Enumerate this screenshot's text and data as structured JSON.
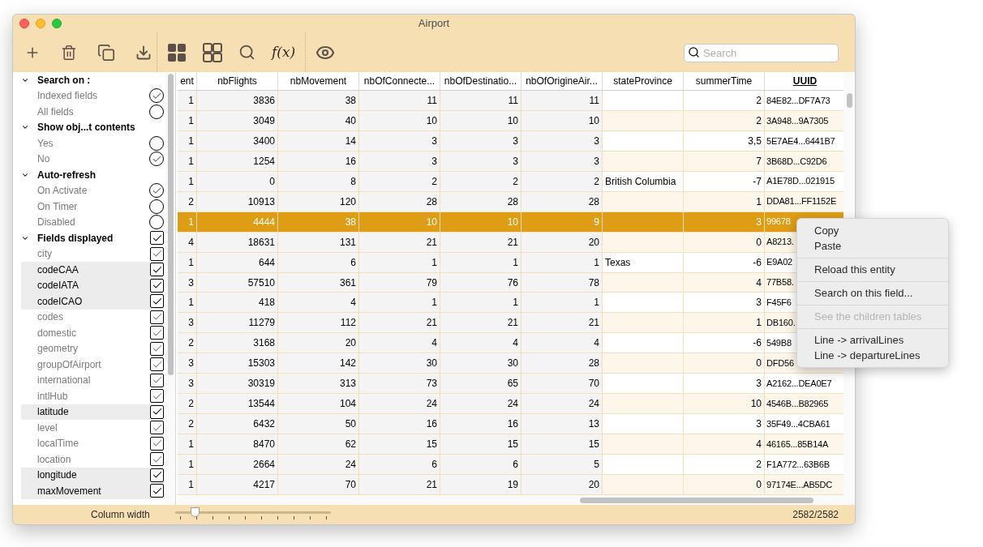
{
  "window": {
    "title": "Airport"
  },
  "toolbar": {
    "formula_label": "f(x)",
    "search": {
      "placeholder": "Search"
    }
  },
  "sidebar": {
    "sections": [
      {
        "title": "Search on :",
        "expanded": true,
        "kind": "radio",
        "items": [
          {
            "label": "Indexed fields",
            "selected": true,
            "highlighted": false
          },
          {
            "label": "All fields",
            "selected": false,
            "highlighted": false
          }
        ]
      },
      {
        "title": "Show obj...t contents",
        "expanded": true,
        "kind": "radio",
        "items": [
          {
            "label": "Yes",
            "selected": false,
            "highlighted": false
          },
          {
            "label": "No",
            "selected": true,
            "highlighted": false
          }
        ]
      },
      {
        "title": "Auto-refresh",
        "expanded": true,
        "kind": "radio",
        "items": [
          {
            "label": "On Activate",
            "selected": true,
            "highlighted": false
          },
          {
            "label": "On Timer",
            "selected": false,
            "highlighted": false
          },
          {
            "label": "Disabled",
            "selected": false,
            "highlighted": false
          }
        ]
      },
      {
        "title": "Fields displayed",
        "expanded": true,
        "kind": "checkbox",
        "checked": true,
        "items": [
          {
            "label": "city",
            "checked": true,
            "highlighted": false
          },
          {
            "label": "codeCAA",
            "checked": true,
            "highlighted": true
          },
          {
            "label": "codeIATA",
            "checked": true,
            "highlighted": true
          },
          {
            "label": "codeICAO",
            "checked": true,
            "highlighted": true
          },
          {
            "label": "codes",
            "checked": true,
            "highlighted": false
          },
          {
            "label": "domestic",
            "checked": true,
            "highlighted": false
          },
          {
            "label": "geometry",
            "checked": true,
            "highlighted": false
          },
          {
            "label": "groupOfAirport",
            "checked": true,
            "highlighted": false
          },
          {
            "label": "international",
            "checked": true,
            "highlighted": false
          },
          {
            "label": "intlHub",
            "checked": true,
            "highlighted": false
          },
          {
            "label": "latitude",
            "checked": true,
            "highlighted": true
          },
          {
            "label": "level",
            "checked": true,
            "highlighted": false
          },
          {
            "label": "localTime",
            "checked": true,
            "highlighted": false
          },
          {
            "label": "location",
            "checked": true,
            "highlighted": false
          },
          {
            "label": "longitude",
            "checked": true,
            "highlighted": true
          },
          {
            "label": "maxMovement",
            "checked": true,
            "highlighted": true
          }
        ]
      }
    ]
  },
  "table": {
    "columns": [
      {
        "label": "ent",
        "kind": "computed"
      },
      {
        "label": "nbFlights",
        "kind": "computed"
      },
      {
        "label": "nbMovement",
        "kind": "computed"
      },
      {
        "label": "nbOfConnecte...",
        "kind": "computed"
      },
      {
        "label": "nbOfDestinatio...",
        "kind": "computed"
      },
      {
        "label": "nbOfOrigineAir...",
        "kind": "computed"
      },
      {
        "label": "stateProvince",
        "kind": "text"
      },
      {
        "label": "summerTime",
        "kind": "number"
      },
      {
        "label": "UUID",
        "kind": "key"
      }
    ],
    "rows": [
      {
        "selected": false,
        "cells": [
          "1",
          "3836",
          "38",
          "11",
          "11",
          "11",
          "",
          "2",
          "84E82...DF7A73"
        ]
      },
      {
        "selected": false,
        "cells": [
          "1",
          "3049",
          "40",
          "10",
          "10",
          "10",
          "",
          "2",
          "3A948...9A7305"
        ]
      },
      {
        "selected": false,
        "cells": [
          "1",
          "3400",
          "14",
          "3",
          "3",
          "3",
          "",
          "3,5",
          "5E7AE4...6441B7"
        ]
      },
      {
        "selected": false,
        "cells": [
          "1",
          "1254",
          "16",
          "3",
          "3",
          "3",
          "",
          "7",
          "3B68D...C92D6"
        ]
      },
      {
        "selected": false,
        "cells": [
          "1",
          "0",
          "8",
          "2",
          "2",
          "2",
          "British Columbia",
          "-7",
          "A1E78D...021915"
        ]
      },
      {
        "selected": false,
        "cells": [
          "2",
          "10913",
          "120",
          "28",
          "28",
          "28",
          "",
          "1",
          "DDA81...FF1152E"
        ]
      },
      {
        "selected": true,
        "cells": [
          "1",
          "4444",
          "38",
          "10",
          "10",
          "9",
          "",
          "3",
          "99678"
        ]
      },
      {
        "selected": false,
        "cells": [
          "4",
          "18631",
          "131",
          "21",
          "21",
          "20",
          "",
          "0",
          "A8213."
        ]
      },
      {
        "selected": false,
        "cells": [
          "1",
          "644",
          "6",
          "1",
          "1",
          "1",
          "Texas",
          "-6",
          "E9A02"
        ]
      },
      {
        "selected": false,
        "cells": [
          "3",
          "57510",
          "361",
          "79",
          "76",
          "78",
          "",
          "4",
          "77B58."
        ]
      },
      {
        "selected": false,
        "cells": [
          "1",
          "418",
          "4",
          "1",
          "1",
          "1",
          "",
          "3",
          "F45F6"
        ]
      },
      {
        "selected": false,
        "cells": [
          "3",
          "11279",
          "112",
          "21",
          "21",
          "21",
          "",
          "1",
          "DB160."
        ]
      },
      {
        "selected": false,
        "cells": [
          "2",
          "3168",
          "20",
          "4",
          "4",
          "4",
          "",
          "-6",
          "549B8"
        ]
      },
      {
        "selected": false,
        "cells": [
          "3",
          "15303",
          "142",
          "30",
          "30",
          "28",
          "",
          "0",
          "DFD56"
        ]
      },
      {
        "selected": false,
        "cells": [
          "3",
          "30319",
          "313",
          "73",
          "65",
          "70",
          "",
          "3",
          "A2162...DEA0E7"
        ]
      },
      {
        "selected": false,
        "cells": [
          "2",
          "13544",
          "104",
          "24",
          "24",
          "24",
          "",
          "10",
          "4546B...B82965"
        ]
      },
      {
        "selected": false,
        "cells": [
          "2",
          "6432",
          "50",
          "16",
          "16",
          "13",
          "",
          "3",
          "35F49...4CBA61"
        ]
      },
      {
        "selected": false,
        "cells": [
          "1",
          "8470",
          "62",
          "15",
          "15",
          "15",
          "",
          "4",
          "46165...85B14A"
        ]
      },
      {
        "selected": false,
        "cells": [
          "1",
          "2664",
          "24",
          "6",
          "6",
          "5",
          "",
          "2",
          "F1A772...63B6B"
        ]
      },
      {
        "selected": false,
        "cells": [
          "1",
          "4217",
          "70",
          "21",
          "19",
          "20",
          "",
          "0",
          "97174E...AB5DC"
        ]
      }
    ]
  },
  "context_menu": {
    "groups": [
      [
        {
          "label": "Copy",
          "disabled": false
        },
        {
          "label": "Paste",
          "disabled": false
        }
      ],
      [
        {
          "label": "Reload this entity",
          "disabled": false
        }
      ],
      [
        {
          "label": "Search on this field...",
          "disabled": false
        }
      ],
      [
        {
          "label": "See the children tables",
          "disabled": true
        }
      ],
      [
        {
          "label": "Line -> arrivalLines",
          "disabled": false
        },
        {
          "label": "Line -> departureLines",
          "disabled": false
        }
      ]
    ]
  },
  "status_bar": {
    "column_width_label": "Column width",
    "column_width": {
      "level": 0.13
    },
    "count": "2582/2582"
  }
}
